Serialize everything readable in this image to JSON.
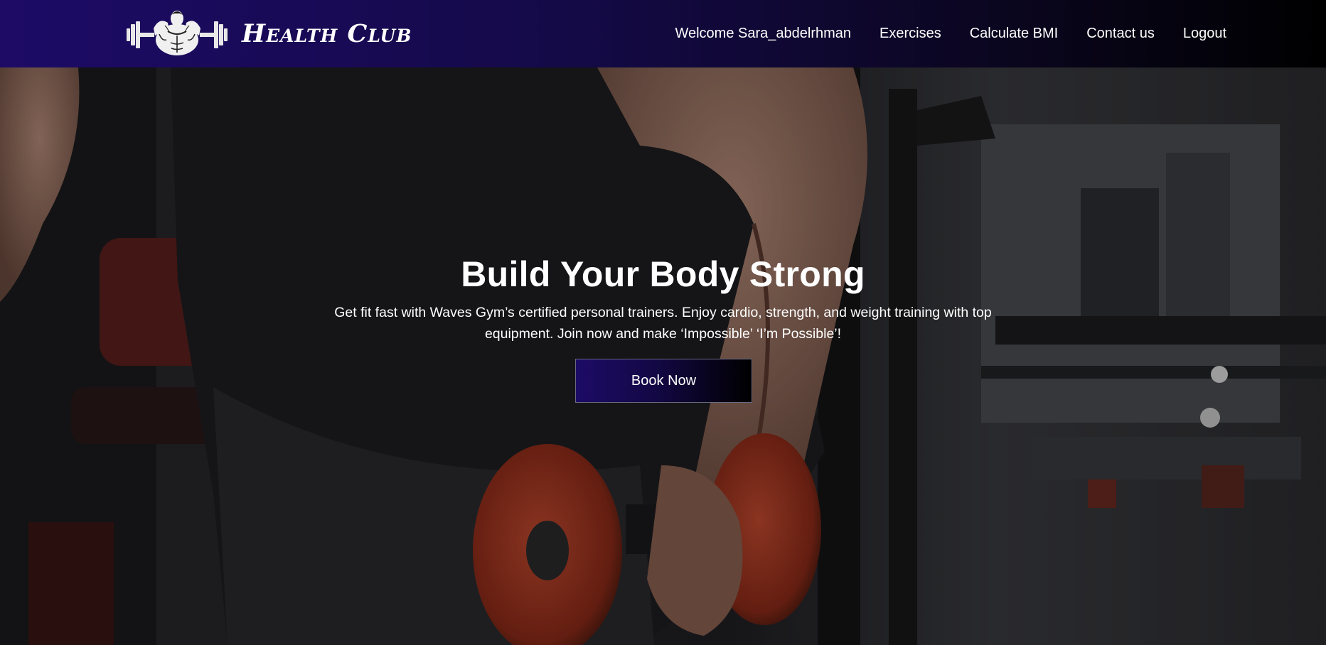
{
  "brand": {
    "name": "Health Club",
    "logo_icon": "bodybuilder-dumbbell-logo"
  },
  "nav": {
    "welcome": "Welcome Sara_abdelrhman",
    "exercises": "Exercises",
    "bmi": "Calculate BMI",
    "contact": "Contact us",
    "logout": "Logout"
  },
  "hero": {
    "title": "Build Your Body Strong",
    "text": "Get fit fast with Waves Gym’s certified personal trainers. Enjoy cardio, strength, and weight training with top equipment. Join now and make ‘Impossible’ ‘I’m Possible’!",
    "button": "Book Now",
    "background_image": "man-lifting-red-dumbbell-in-gym"
  },
  "colors": {
    "navbar_start": "#1d0b66",
    "navbar_end": "#000000",
    "button_start": "#1d0b66",
    "button_end": "#000000",
    "text": "#ffffff"
  }
}
